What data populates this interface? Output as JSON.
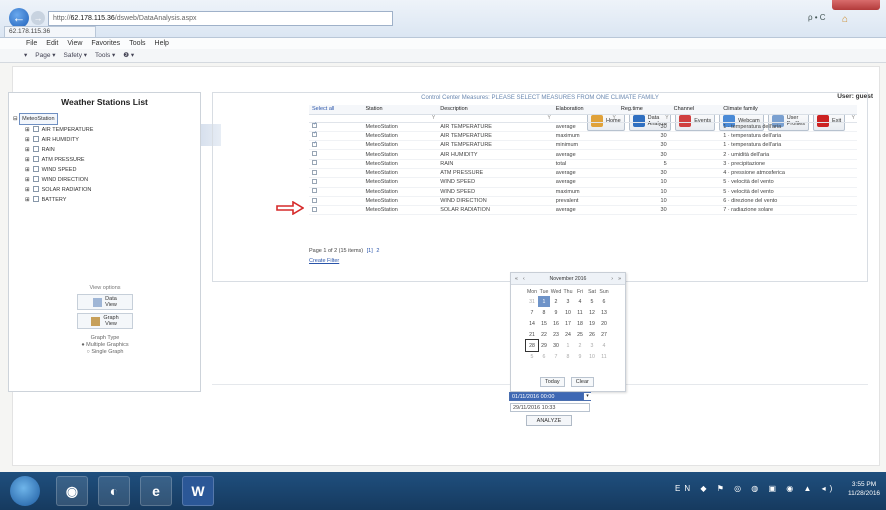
{
  "browser": {
    "address_prefix": "http://",
    "address_host": "62.178.115.36",
    "address_rest": "/dsweb/DataAnalysis.aspx",
    "search_ctl": "ρ • C",
    "tab_label": "62.178.115.36",
    "menu": [
      "File",
      "Edit",
      "View",
      "Favorites",
      "Tools",
      "Help"
    ],
    "commands": [
      "▾",
      "Page ▾",
      "Safety ▾",
      "Tools ▾",
      "❷ ▾"
    ]
  },
  "app": {
    "user_label": "User: guest",
    "logo_text": "mix",
    "logo_small": "srl",
    "nav": [
      {
        "label": "Home",
        "color": "#e0a23a"
      },
      {
        "label": "Data\nAnalyze",
        "color": "#2f6fc0"
      },
      {
        "label": "Events",
        "color": "#d04040"
      },
      {
        "label": "Webcam",
        "color": "#4a8ad6"
      },
      {
        "label": "User\nProfiles",
        "color": "#7aa0d0"
      },
      {
        "label": "Exit",
        "color": "#cc2222"
      }
    ]
  },
  "sidebar": {
    "title": "Weather Stations List",
    "root": "MeteoStation",
    "items": [
      "AIR TEMPERATURE",
      "AIR HUMIDITY",
      "RAIN",
      "ATM PRESSURE",
      "WIND SPEED",
      "WIND DIRECTION",
      "SOLAR RADIATION",
      "BATTERY"
    ],
    "view_options": "View options",
    "data_view": "Data\nView",
    "graph_view": "Graph\nView",
    "graph_type": "Graph Type",
    "graph_type_opts": [
      "Multiple Graphics",
      "Single Graph"
    ]
  },
  "main": {
    "title": "Control Center Measures: PLEASE SELECT MEASURES FROM ONE CLIMATE FAMILY",
    "columns": [
      "Select all",
      "Station",
      "Description",
      "Elaboration",
      "Reg.time",
      "Channel",
      "Climate family"
    ],
    "rows": [
      {
        "checked": true,
        "station": "MeteoStation",
        "desc": "AIR TEMPERATURE",
        "elab": "average",
        "reg": "30",
        "family": "1 · temperatura dell'aria"
      },
      {
        "checked": true,
        "station": "MeteoStation",
        "desc": "AIR TEMPERATURE",
        "elab": "maximum",
        "reg": "30",
        "family": "1 · temperatura dell'aria"
      },
      {
        "checked": true,
        "station": "MeteoStation",
        "desc": "AIR TEMPERATURE",
        "elab": "minimum",
        "reg": "30",
        "family": "1 · temperatura dell'aria"
      },
      {
        "checked": false,
        "station": "MeteoStation",
        "desc": "AIR HUMIDITY",
        "elab": "average",
        "reg": "30",
        "family": "2 · umidità dell'aria"
      },
      {
        "checked": false,
        "station": "MeteoStation",
        "desc": "RAIN",
        "elab": "total",
        "reg": "5",
        "family": "3 · precipitazione"
      },
      {
        "checked": false,
        "station": "MeteoStation",
        "desc": "ATM PRESSURE",
        "elab": "average",
        "reg": "30",
        "family": "4 · pressione atmosferica"
      },
      {
        "checked": false,
        "station": "MeteoStation",
        "desc": "WIND SPEED",
        "elab": "average",
        "reg": "10",
        "family": "5 · velocità del vento"
      },
      {
        "checked": false,
        "station": "MeteoStation",
        "desc": "WIND SPEED",
        "elab": "maximum",
        "reg": "10",
        "family": "5 · velocità del vento"
      },
      {
        "checked": false,
        "station": "MeteoStation",
        "desc": "WIND DIRECTION",
        "elab": "prevalent",
        "reg": "10",
        "family": "6 · direzione del vento"
      },
      {
        "checked": false,
        "station": "MeteoStation",
        "desc": "SOLAR RADIATION",
        "elab": "average",
        "reg": "30",
        "family": "7 · radiazione solare"
      }
    ],
    "pager": "Page 1 of 2 (15 items)",
    "pages": [
      "[1]",
      "2"
    ],
    "create_filter": "Create Filter"
  },
  "calendar": {
    "month": "November 2016",
    "days": [
      "Mon",
      "Tue",
      "Wed",
      "Thu",
      "Fri",
      "Sat",
      "Sun"
    ],
    "weeks": [
      [
        "31",
        "1",
        "2",
        "3",
        "4",
        "5",
        "6"
      ],
      [
        "7",
        "8",
        "9",
        "10",
        "11",
        "12",
        "13"
      ],
      [
        "14",
        "15",
        "16",
        "17",
        "18",
        "19",
        "20"
      ],
      [
        "21",
        "22",
        "23",
        "24",
        "25",
        "26",
        "27"
      ],
      [
        "28",
        "29",
        "30",
        "1",
        "2",
        "3",
        "4"
      ],
      [
        "5",
        "6",
        "7",
        "8",
        "9",
        "10",
        "11"
      ]
    ],
    "today_btn": "Today",
    "clear_btn": "Clear",
    "from_value": "01/11/2016 00:00",
    "to_value": "29/11/2016 10:33",
    "analyze_btn": "ANALYZE"
  },
  "taskbar": {
    "tray": "EN ◆ ⚑ ◎ ◍ ▣ ◉ ▲ ◂)",
    "time": "3:55 PM",
    "date": "11/28/2016"
  }
}
